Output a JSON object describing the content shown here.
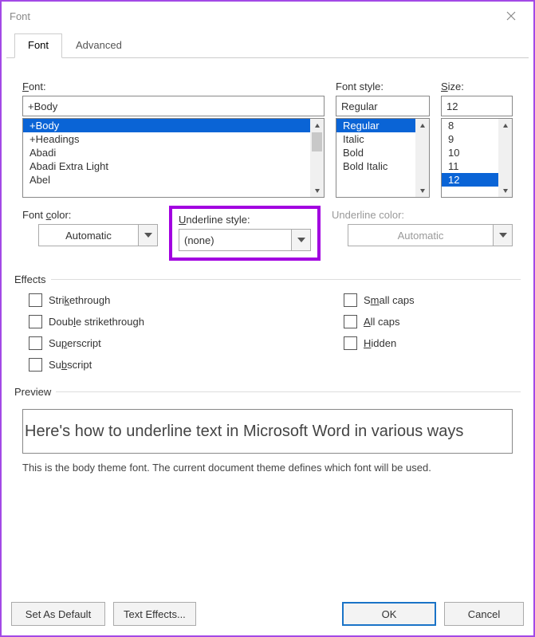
{
  "window": {
    "title": "Font"
  },
  "tabs": {
    "font": "Font",
    "advanced": "Advanced"
  },
  "labels": {
    "font_f": "F",
    "font_rest": "ont:",
    "fontstyle": "Font style:",
    "size_s": "S",
    "size_rest": "ize:",
    "fontcolor_pre": "Font ",
    "fontcolor_u": "c",
    "fontcolor_post": "olor:",
    "ustyle_u": "U",
    "ustyle_rest": "nderline style:",
    "ucolor": "Underline color:"
  },
  "font": {
    "value": "+Body",
    "items": [
      "+Body",
      "+Headings",
      "Abadi",
      "Abadi Extra Light",
      "Abel"
    ],
    "selected_index": 0
  },
  "style": {
    "value": "Regular",
    "items": [
      "Regular",
      "Italic",
      "Bold",
      "Bold Italic"
    ],
    "selected_index": 0
  },
  "size": {
    "value": "12",
    "items": [
      "8",
      "9",
      "10",
      "11",
      "12"
    ],
    "selected_index": 4
  },
  "font_color": {
    "text": "Automatic"
  },
  "underline_style": {
    "text": "(none)"
  },
  "underline_color": {
    "text": "Automatic"
  },
  "effects": {
    "header": "Effects",
    "strike_pre": "Stri",
    "strike_u": "k",
    "strike_post": "ethrough",
    "dstrike_pre": "Doub",
    "dstrike_u": "l",
    "dstrike_post": "e strikethrough",
    "super_pre": "Su",
    "super_u": "p",
    "super_post": "erscript",
    "sub_pre": "Su",
    "sub_u": "b",
    "sub_post": "script",
    "small_pre": "S",
    "small_u": "m",
    "small_post": "all caps",
    "all_u": "A",
    "all_post": "ll caps",
    "hidden_pre": "",
    "hidden_u": "H",
    "hidden_post": "idden"
  },
  "preview": {
    "header": "Preview",
    "text": "Here's how to underline text in Microsoft Word in various ways",
    "desc": "This is the body theme font. The current document theme defines which font will be used."
  },
  "buttons": {
    "set_default": "Set As Default",
    "text_effects": "Text Effects...",
    "ok": "OK",
    "cancel": "Cancel"
  }
}
